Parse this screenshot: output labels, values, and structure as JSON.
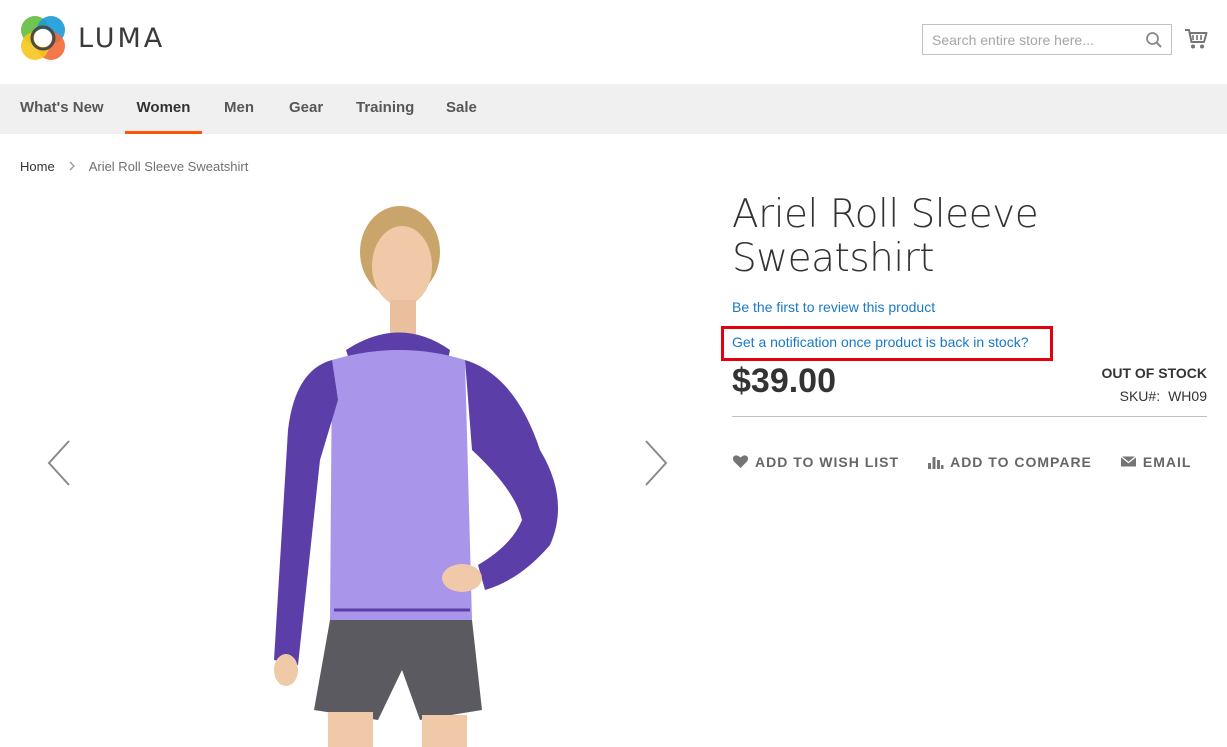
{
  "header": {
    "logo_text": "LUMA",
    "search_placeholder": "Search entire store here...",
    "search_icon": "search-icon",
    "cart_icon": "shopping-cart-icon"
  },
  "nav": {
    "items": [
      {
        "label": "What's New",
        "active": false
      },
      {
        "label": "Women",
        "active": true
      },
      {
        "label": "Men",
        "active": false
      },
      {
        "label": "Gear",
        "active": false
      },
      {
        "label": "Training",
        "active": false
      },
      {
        "label": "Sale",
        "active": false
      }
    ]
  },
  "breadcrumb": {
    "home": "Home",
    "separator": ">",
    "current": "Ariel Roll Sleeve Sweatshirt"
  },
  "product": {
    "title": "Ariel Roll Sleeve Sweatshirt",
    "review_link": "Be the first to review this product",
    "notify_link": "Get a notification once product is back in stock?",
    "price": "$39.00",
    "stock_status": "OUT OF STOCK",
    "sku_label": "SKU#:",
    "sku_value": "WH09"
  },
  "actions": {
    "wishlist": "ADD TO WISH LIST",
    "compare": "ADD TO COMPARE",
    "email": "EMAIL"
  },
  "colors": {
    "accent": "#ff5501",
    "link": "#1979c3",
    "highlight_box": "#e4000f",
    "nav_bg": "#f0f0f0"
  }
}
